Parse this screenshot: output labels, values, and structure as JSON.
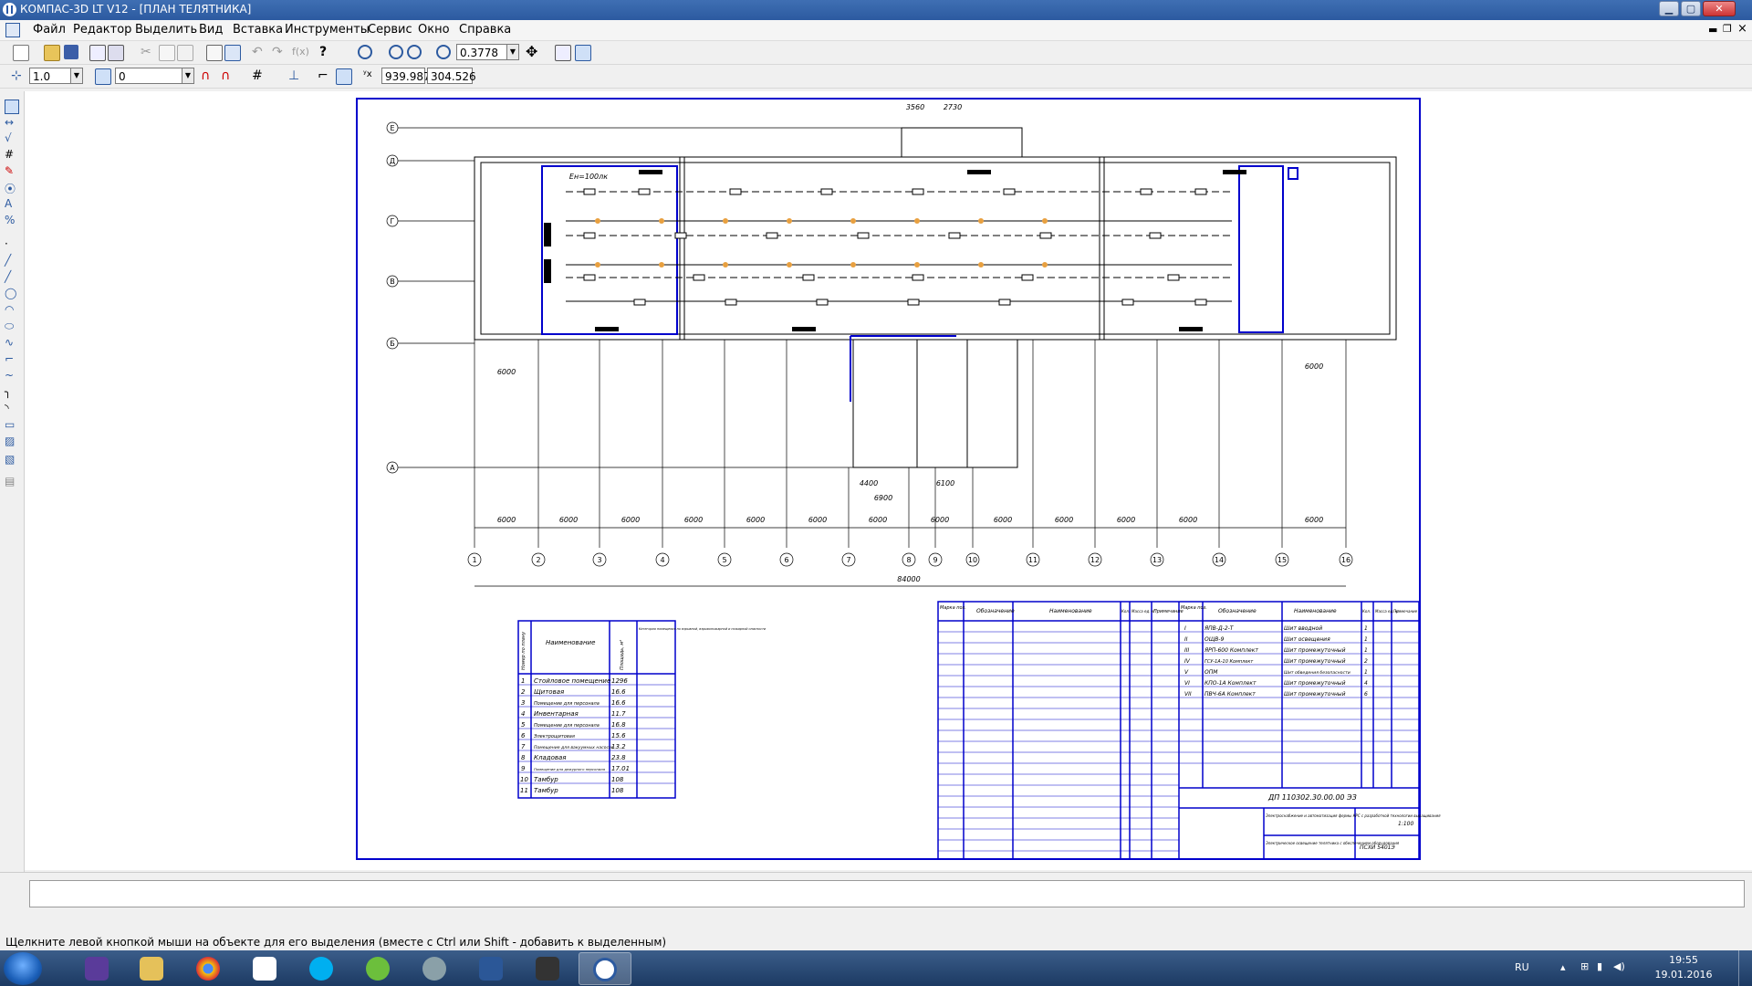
{
  "window": {
    "title": "КОМПАС-3D LT V12 - [ПЛАН ТЕЛЯТНИКА]"
  },
  "menu": [
    {
      "label": "Файл"
    },
    {
      "label": "Редактор"
    },
    {
      "label": "Выделить"
    },
    {
      "label": "Вид"
    },
    {
      "label": "Вставка"
    },
    {
      "label": "Инструменты"
    },
    {
      "label": "Сервис"
    },
    {
      "label": "Окно"
    },
    {
      "label": "Справка"
    }
  ],
  "toolbar": {
    "zoom_value": "0.3778",
    "step_value": "1.0",
    "layer_value": "0",
    "coord_x": "939.987",
    "coord_y": "304.526"
  },
  "drawing": {
    "total_dimension": "84000",
    "grid_spacing_label": "6000",
    "bottom_dims": [
      "6000",
      "6000",
      "6000",
      "6000",
      "6000",
      "6000",
      "6000",
      "6000",
      "6000",
      "6000",
      "6000",
      "6000",
      "6000"
    ],
    "axis_letters": [
      "Е",
      "Д",
      "Г",
      "В",
      "Б",
      "А"
    ],
    "axis_numbers": [
      "1",
      "2",
      "3",
      "4",
      "5",
      "6",
      "7",
      "8",
      "9",
      "10",
      "11",
      "12",
      "13",
      "14",
      "15",
      "16"
    ],
    "top_dims": [
      "3560",
      "2730"
    ],
    "annex_dims": [
      "4400",
      "6900",
      "6100"
    ],
    "illuminance_note": "Ен=100лк"
  },
  "explication": {
    "headers": {
      "num": "Номер по плану",
      "name": "Наименование",
      "area": "Площадь, м²",
      "cat": "Категория помещения по взрывной, взрывопожарной и пожарной опасности"
    },
    "rows": [
      {
        "num": "1",
        "name": "Стойловое помещение",
        "area": "1296"
      },
      {
        "num": "2",
        "name": "Щитовая",
        "area": "16.6"
      },
      {
        "num": "3",
        "name": "Помещение для персонала",
        "area": "16.6"
      },
      {
        "num": "4",
        "name": "Инвентарная",
        "area": "11.7"
      },
      {
        "num": "5",
        "name": "Помещение для персонала",
        "area": "16.8"
      },
      {
        "num": "6",
        "name": "Электрощитовая",
        "area": "15.6"
      },
      {
        "num": "7",
        "name": "Помещение для вакуумных насосов",
        "area": "13.2"
      },
      {
        "num": "8",
        "name": "Кладовая",
        "area": "23.8"
      },
      {
        "num": "9",
        "name": "Помещение для дежурного персонала",
        "area": "17.01"
      },
      {
        "num": "10",
        "name": "Тамбур",
        "area": "108"
      },
      {
        "num": "11",
        "name": "Тамбур",
        "area": "108"
      }
    ]
  },
  "spec": {
    "headers_left": [
      "Марка поз.",
      "Обозначение",
      "Наименование",
      "Кол.",
      "Масса ед. кг",
      "Примечание"
    ],
    "headers_right": [
      "Марка поз.",
      "Обозначение",
      "Наименование",
      "Кол.",
      "Масса ед. кг",
      "Примечание"
    ],
    "right_rows": [
      {
        "pos": "I",
        "desig": "ЯПВ-Д-2-Т",
        "name": "Шит вводной",
        "qty": "1"
      },
      {
        "pos": "II",
        "desig": "ОЩВ-9",
        "name": "Шит освещения",
        "qty": "1"
      },
      {
        "pos": "III",
        "desig": "ЯРП-600 Комплект",
        "name": "Шит промежуточный",
        "qty": "1"
      },
      {
        "pos": "IV",
        "desig": "ГСУ-1А-10 Комплект",
        "name": "Шит промежуточный",
        "qty": "2"
      },
      {
        "pos": "V",
        "desig": "ОПМ",
        "name": "Шит обведения безопасности",
        "qty": "1"
      },
      {
        "pos": "VI",
        "desig": "КПО-1А Комплект",
        "name": "Шит промежуточный",
        "qty": "4"
      },
      {
        "pos": "VII",
        "desig": "ПВЧ-6А Комплект",
        "name": "Шит промежуточный",
        "qty": "6"
      }
    ],
    "stamp_code": "ДП 110302.30.00.00 ЭЗ",
    "stamp_title": "Электроснабжение и автоматизация фермы КРС с разработкой технологии выращивания",
    "stamp_subtitle": "Электрическое освещение телятника с обеспечением оборудования",
    "stamp_scale": "1:100",
    "stamp_org": "ПСХИ  5401Э"
  },
  "status": {
    "hint": "Щелкните левой кнопкой мыши на объекте для его выделения (вместе с Ctrl или Shift - добавить к выделенным)"
  },
  "taskbar": {
    "lang": "RU",
    "time": "19:55",
    "date": "19.01.2016"
  }
}
